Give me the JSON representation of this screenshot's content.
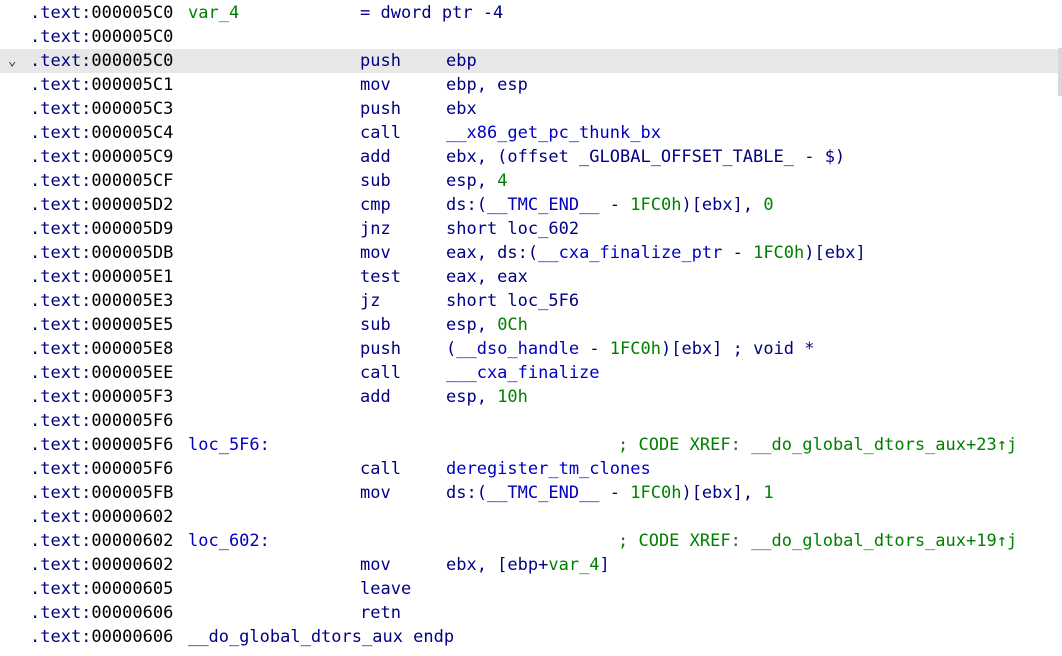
{
  "window": {
    "view": "IDA View"
  },
  "lines": [
    {
      "addr": "000005C0",
      "label": "var_4",
      "label_kind": "var",
      "eq": "= dword ptr -4"
    },
    {
      "addr": "000005C0"
    },
    {
      "addr": "000005C0",
      "selected": true,
      "collapse": "⌄",
      "mnemonic": "push",
      "operands": [
        {
          "t": "ebp",
          "c": "reg"
        }
      ]
    },
    {
      "addr": "000005C1",
      "mnemonic": "mov",
      "operands": [
        {
          "t": "ebp, esp",
          "c": "reg"
        }
      ]
    },
    {
      "addr": "000005C3",
      "mnemonic": "push",
      "operands": [
        {
          "t": "ebx",
          "c": "reg"
        }
      ]
    },
    {
      "addr": "000005C4",
      "mnemonic": "call",
      "operands": [
        {
          "t": "__x86_get_pc_thunk_bx",
          "c": "sym"
        }
      ]
    },
    {
      "addr": "000005C9",
      "mnemonic": "add",
      "operands": [
        {
          "t": "ebx, (offset _GLOBAL_OFFSET_TABLE_ - $)",
          "c": "reg"
        }
      ]
    },
    {
      "addr": "000005CF",
      "mnemonic": "sub",
      "operands": [
        {
          "t": "esp, ",
          "c": "reg"
        },
        {
          "t": "4",
          "c": "num"
        }
      ]
    },
    {
      "addr": "000005D2",
      "mnemonic": "cmp",
      "operands": [
        {
          "t": "ds:(",
          "c": "reg"
        },
        {
          "t": "__TMC_END__",
          "c": "sym"
        },
        {
          "t": " - ",
          "c": "reg"
        },
        {
          "t": "1FC0h",
          "c": "num"
        },
        {
          "t": ")[ebx], ",
          "c": "reg"
        },
        {
          "t": "0",
          "c": "num"
        }
      ]
    },
    {
      "addr": "000005D9",
      "mnemonic": "jnz",
      "operands": [
        {
          "t": "short loc_602",
          "c": "reg"
        }
      ]
    },
    {
      "addr": "000005DB",
      "mnemonic": "mov",
      "operands": [
        {
          "t": "eax, ds:(",
          "c": "reg"
        },
        {
          "t": "__cxa_finalize_ptr",
          "c": "sym"
        },
        {
          "t": " - ",
          "c": "reg"
        },
        {
          "t": "1FC0h",
          "c": "num"
        },
        {
          "t": ")[ebx]",
          "c": "reg"
        }
      ]
    },
    {
      "addr": "000005E1",
      "mnemonic": "test",
      "operands": [
        {
          "t": "eax, eax",
          "c": "reg"
        }
      ]
    },
    {
      "addr": "000005E3",
      "mnemonic": "jz",
      "operands": [
        {
          "t": "short loc_5F6",
          "c": "reg"
        }
      ]
    },
    {
      "addr": "000005E5",
      "mnemonic": "sub",
      "operands": [
        {
          "t": "esp, ",
          "c": "reg"
        },
        {
          "t": "0Ch",
          "c": "num"
        }
      ]
    },
    {
      "addr": "000005E8",
      "mnemonic": "push",
      "operands": [
        {
          "t": "(",
          "c": "reg"
        },
        {
          "t": "__dso_handle",
          "c": "sym"
        },
        {
          "t": " - ",
          "c": "reg"
        },
        {
          "t": "1FC0h",
          "c": "num"
        },
        {
          "t": ")[ebx] ; void *",
          "c": "reg"
        }
      ]
    },
    {
      "addr": "000005EE",
      "mnemonic": "call",
      "operands": [
        {
          "t": "___cxa_finalize",
          "c": "imp"
        }
      ]
    },
    {
      "addr": "000005F3",
      "mnemonic": "add",
      "operands": [
        {
          "t": "esp, ",
          "c": "reg"
        },
        {
          "t": "10h",
          "c": "num"
        }
      ]
    },
    {
      "addr": "000005F6"
    },
    {
      "addr": "000005F6",
      "label": "loc_5F6:",
      "label_kind": "loc",
      "comment": [
        {
          "t": "; CODE XREF: ",
          "c": "cmt"
        },
        {
          "t": "__do_global_dtors_aux+23↑j",
          "c": "cmt"
        }
      ]
    },
    {
      "addr": "000005F6",
      "mnemonic": "call",
      "operands": [
        {
          "t": "deregister_tm_clones",
          "c": "sym"
        }
      ]
    },
    {
      "addr": "000005FB",
      "mnemonic": "mov",
      "operands": [
        {
          "t": "ds:(",
          "c": "reg"
        },
        {
          "t": "__TMC_END__",
          "c": "sym"
        },
        {
          "t": " - ",
          "c": "reg"
        },
        {
          "t": "1FC0h",
          "c": "num"
        },
        {
          "t": ")[ebx], ",
          "c": "reg"
        },
        {
          "t": "1",
          "c": "num"
        }
      ]
    },
    {
      "addr": "00000602"
    },
    {
      "addr": "00000602",
      "label": "loc_602:",
      "label_kind": "loc",
      "comment": [
        {
          "t": "; CODE XREF: ",
          "c": "cmt"
        },
        {
          "t": "__do_global_dtors_aux+19↑j",
          "c": "cmt"
        }
      ]
    },
    {
      "addr": "00000602",
      "mnemonic": "mov",
      "operands": [
        {
          "t": "ebx, [ebp+",
          "c": "reg"
        },
        {
          "t": "var_4",
          "c": "var"
        },
        {
          "t": "]",
          "c": "reg"
        }
      ]
    },
    {
      "addr": "00000605",
      "mnemonic": "leave"
    },
    {
      "addr": "00000606",
      "mnemonic": "retn"
    },
    {
      "addr": "00000606",
      "label": "__do_global_dtors_aux endp",
      "label_kind": "endp"
    }
  ],
  "segment": ".text:",
  "colors": {
    "selected_row": "#e8e8e8",
    "keyword": "#000080",
    "symbol": "#0000c0",
    "number": "#008000",
    "comment": "#008000"
  }
}
